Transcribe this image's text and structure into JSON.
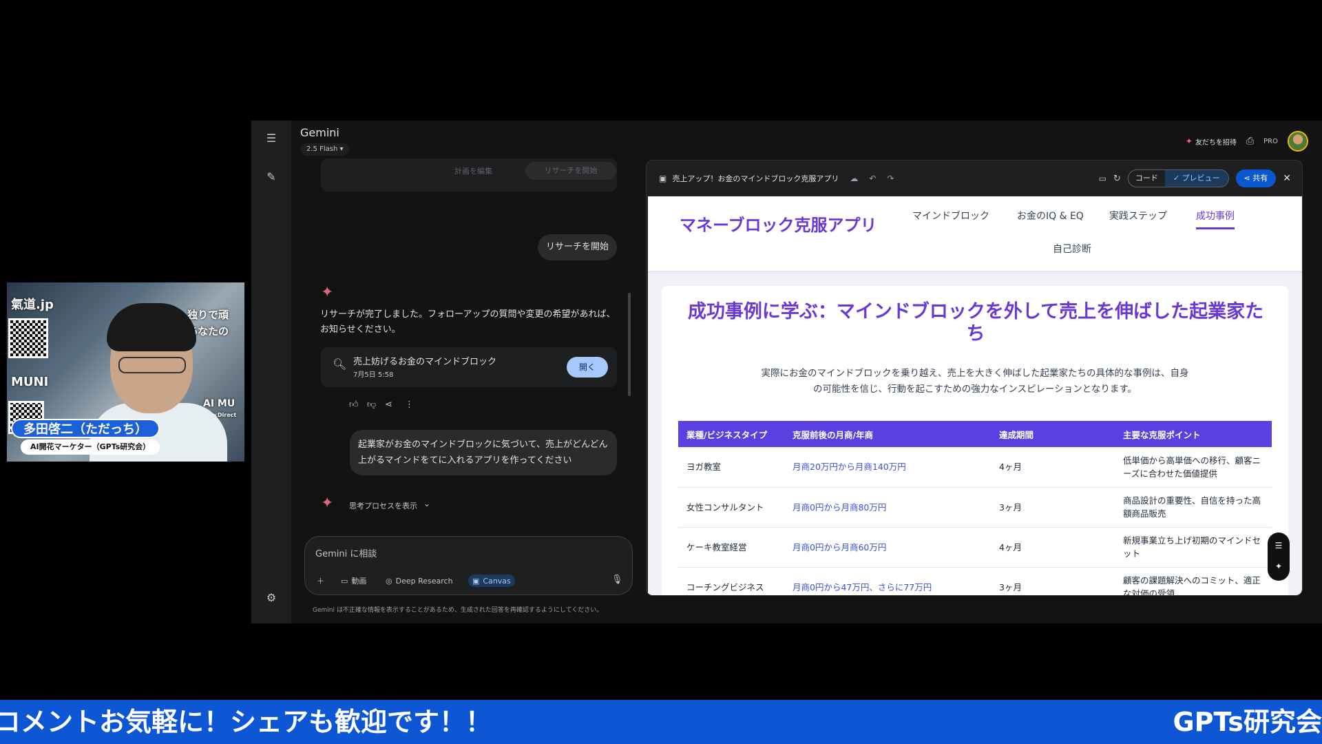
{
  "webcam": {
    "banner_top_left": "氣道.jp",
    "banner_top_right_1": "独りで頑",
    "banner_top_right_2": "あなたの",
    "banner_muni": "MUNI",
    "banner_aimu": "AI MU",
    "banner_direct": "AI×Direct",
    "name": "多田啓二（ただっち）",
    "role": "AI開花マーケター（GPTs研究会）"
  },
  "app": {
    "title": "Gemini",
    "model": "2.5 Flash",
    "invite_label": "友だちを招待",
    "pro_label": "PRO"
  },
  "chat": {
    "plan_edit": "計画を編集",
    "plan_start": "リサーチを開始",
    "user_message_1": "リサーチを開始",
    "reply": "リサーチが完了しました。フォローアップの質問や変更の希望があれば、お知らせください。",
    "doc_title": "売上妨げるお金のマインドブロック",
    "doc_date": "7月5日 5:58",
    "open_label": "開く",
    "user_message_2": "起業家がお金のマインドブロックに気づいて、売上がどんどん上がるマインドをてに入れるアプリを作ってください",
    "thinking_label": "思考プロセスを表示"
  },
  "input": {
    "placeholder": "Gemini に相談",
    "tools": [
      "動画",
      "Deep Research",
      "Canvas"
    ],
    "disclaimer": "Gemini は不正確な情報を表示することがあるため、生成された回答を再確認するようにしてください。"
  },
  "canvas": {
    "title": "売上アップ！お金のマインドブロック克服アプリ",
    "code_label": "コード",
    "preview_label": "プレビュー",
    "share_label": "共有"
  },
  "site": {
    "brand": "マネーブロック克服アプリ",
    "nav": [
      "マインドブロック",
      "お金のIQ & EQ",
      "実践ステップ",
      "成功事例",
      "自己診断"
    ],
    "heading": "成功事例に学ぶ：マインドブロックを外して売上を伸ばした起業家たち",
    "intro": "実際にお金のマインドブロックを乗り越え、売上を大きく伸ばした起業家たちの具体的な事例は、自身の可能性を信じ、行動を起こすための強力なインスピレーションとなります。",
    "table_headers": [
      "業種/ビジネスタイプ",
      "克服前後の月商/年商",
      "達成期間",
      "主要な克服ポイント"
    ],
    "rows": [
      [
        "ヨガ教室",
        "月商20万円から月商140万円",
        "4ヶ月",
        "低単価から高単価への移行、顧客ニーズに合わせた価値提供"
      ],
      [
        "女性コンサルタント",
        "月商0円から月商80万円",
        "3ヶ月",
        "商品設計の重要性、自信を持った高額商品販売"
      ],
      [
        "ケーキ教室経営",
        "月商0円から月商60万円",
        "4ヶ月",
        "新規事業立ち上げ初期のマインドセット"
      ],
      [
        "コーチングビジネス",
        "月商0円から47万円、さらに77万円",
        "3ヶ月",
        "顧客の課題解決へのコミット、適正な対価の受領"
      ]
    ]
  },
  "ticker": {
    "text": "コメントお気軽に！シェアも歓迎です！！",
    "brand": "GPTs研究会"
  }
}
